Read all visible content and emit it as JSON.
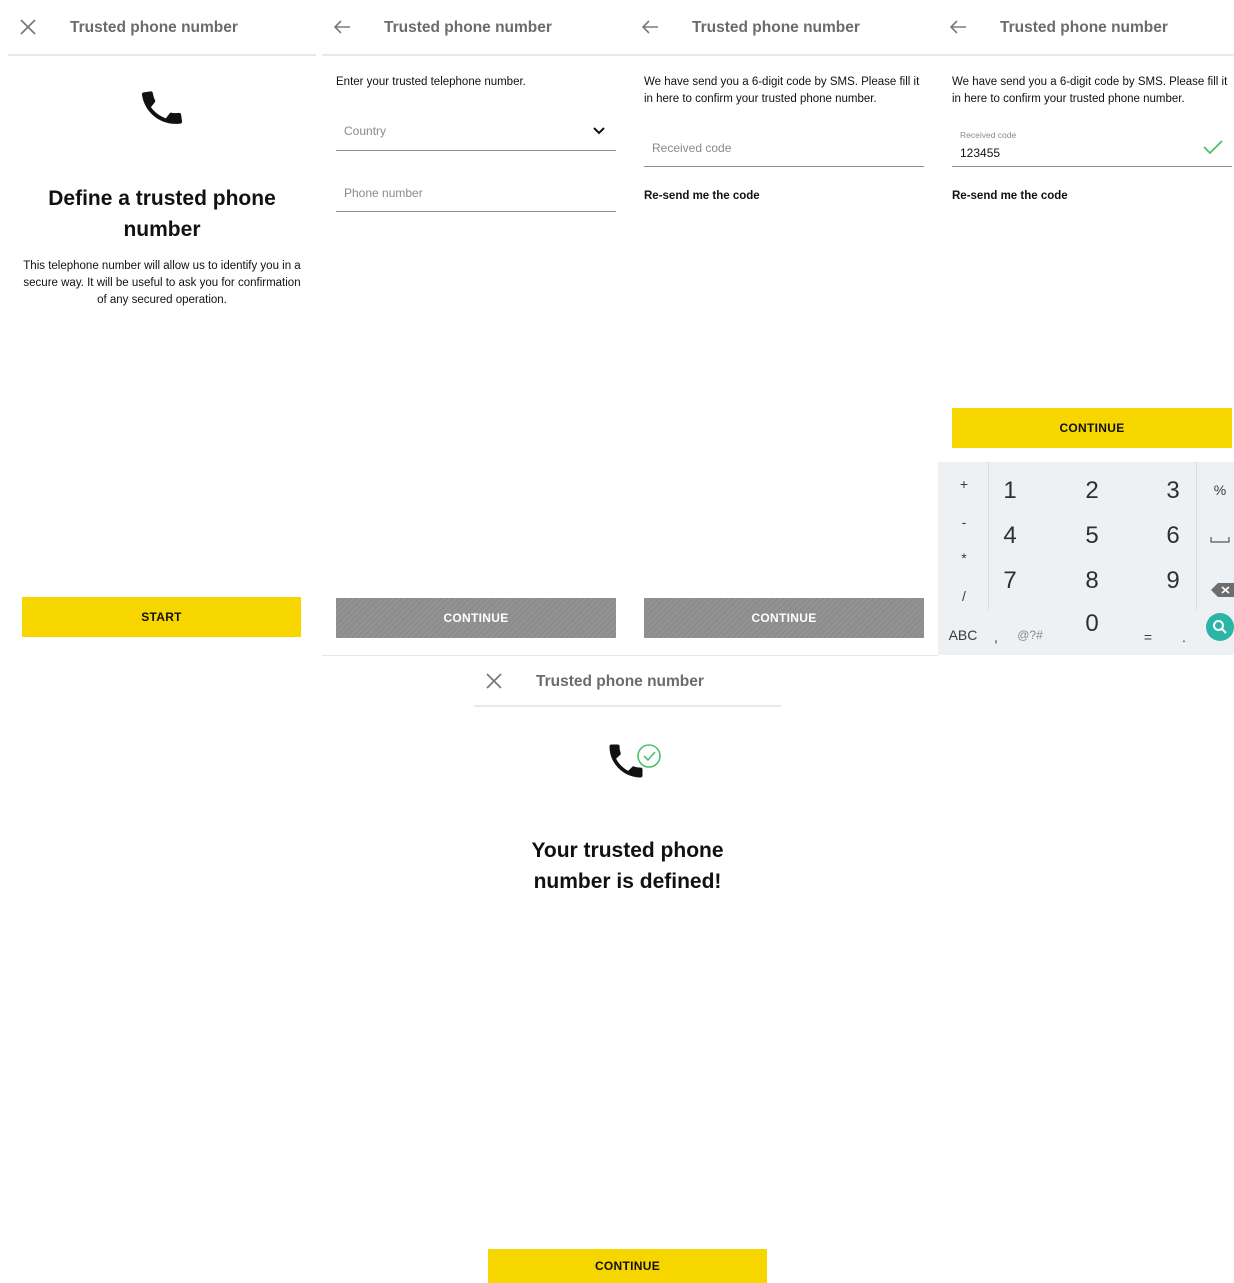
{
  "screens": {
    "s1": {
      "header_title": "Trusted phone number",
      "heading": "Define a trusted phone number",
      "description": "This telephone number will allow us to identify you in a secure way. It will be useful to ask you for confirmation of any secured operation.",
      "button": "START"
    },
    "s2": {
      "header_title": "Trusted phone number",
      "intro": "Enter your trusted telephone number.",
      "country_placeholder": "Country",
      "phone_placeholder": "Phone number",
      "button": "CONTINUE"
    },
    "s3": {
      "header_title": "Trusted phone number",
      "intro": "We have send you a 6-digit code by SMS. Please fill it in here to confirm your trusted phone number.",
      "code_placeholder": "Received code",
      "resend": "Re-send me the code",
      "button": "CONTINUE"
    },
    "s4": {
      "header_title": "Trusted phone number",
      "intro": "We have send you a 6-digit code by SMS. Please fill it in here to confirm your trusted phone number.",
      "code_label": "Received code",
      "code_value": "123455",
      "resend": "Re-send me the code",
      "button": "CONTINUE",
      "keypad": {
        "digits": [
          "1",
          "2",
          "3",
          "4",
          "5",
          "6",
          "7",
          "8",
          "9",
          "0"
        ],
        "symbols": {
          "plus": "+",
          "minus": "-",
          "star": "*",
          "slash": "/",
          "percent": "%",
          "abc": "ABC",
          "comma": ",",
          "special": "@?#",
          "equals": "=",
          "dot": "."
        }
      }
    },
    "s5": {
      "header_title": "Trusted phone number",
      "heading": "Your trusted phone number is defined!",
      "button": "CONTINUE"
    }
  },
  "colors": {
    "accent_yellow": "#f7d600",
    "disabled_grey": "#8c8c8c",
    "success_green": "#4cc16b",
    "search_teal": "#2bb5a7"
  },
  "icons": {
    "close": "close-icon",
    "back": "back-arrow-icon",
    "phone": "phone-icon",
    "phone_check": "phone-check-icon",
    "checkmark": "checkmark-icon",
    "dropdown": "chevron-down-icon"
  }
}
